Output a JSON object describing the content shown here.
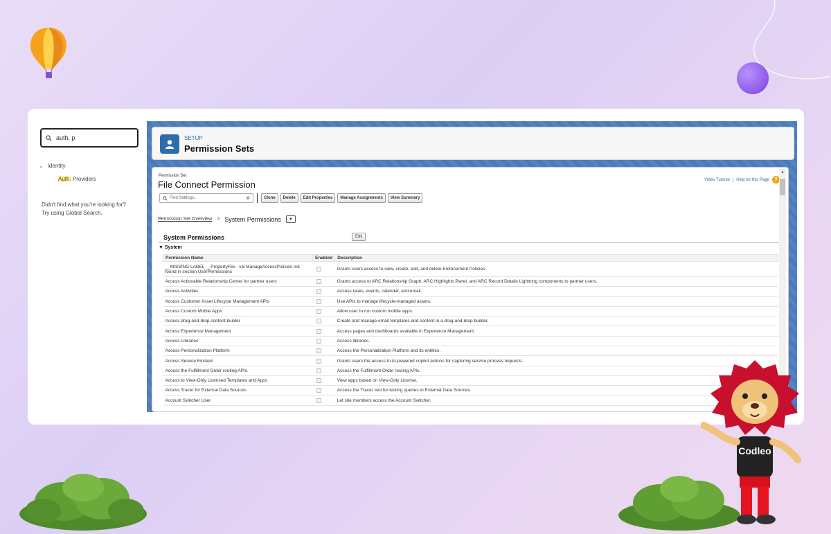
{
  "search": {
    "value": "auth. p"
  },
  "tree": {
    "parent": "Identity",
    "child_highlight": "Auth.",
    "child_rest": " Providers"
  },
  "not_found": {
    "line1": "Didn't find what you're looking for?",
    "line2": "Try using Global Search."
  },
  "header": {
    "setup": "SETUP",
    "title": "Permission Sets"
  },
  "permission_set": {
    "label": "Permission Set",
    "name": "File Connect Permission"
  },
  "help": {
    "video": "Video Tutorial",
    "sep": "|",
    "help": "Help for this Page"
  },
  "toolbar": {
    "find_placeholder": "Find Settings...",
    "buttons": [
      "Clone",
      "Delete",
      "Edit Properties",
      "Manage Assignments",
      "View Summary"
    ]
  },
  "breadcrumb": {
    "link": "Permission Set Overview",
    "sep": ">",
    "current": "System Permissions"
  },
  "section": {
    "title": "System Permissions",
    "edit": "Edit",
    "group": "System"
  },
  "table": {
    "headers": [
      "Permission Name",
      "Enabled",
      "Description"
    ],
    "rows": [
      [
        "__MISSING LABEL__ PropertyFile - val ManageAccessPolicies not found in section UserPermissions",
        "Grants users access to view, create, edit, and delete Enforcement Policies"
      ],
      [
        "Access Actionable Relationship Center for partner users",
        "Grants access to ARC Relationship Graph, ARC Highlights Panel, and ARC Record Details Lightning components to partner users."
      ],
      [
        "Access Activities",
        "Access tasks, events, calendar, and email."
      ],
      [
        "Access Customer Asset Lifecycle Management APIs",
        "Use APIs to manage lifecycle-managed assets."
      ],
      [
        "Access Custom Mobile Apps",
        "Allow user to run custom mobile apps."
      ],
      [
        "Access drag-and-drop content builder",
        "Create and manage email templates and content in a drag-and-drop builder."
      ],
      [
        "Access Experience Management",
        "Access pages and dashboards available in Experience Management."
      ],
      [
        "Access Libraries",
        "Access libraries."
      ],
      [
        "Access Personalization Platform",
        "Access the Personalization Platform and its entities."
      ],
      [
        "Access Service Einstein",
        "Grants users the access to AI-powered copilot actions for capturing service process requests."
      ],
      [
        "Access the Fulfillment Order routing APIs.",
        "Access the Fulfillment Order routing APIs."
      ],
      [
        "Access to View-Only Licensed Templates and Apps",
        "View apps based on View-Only License."
      ],
      [
        "Access Tracer for External Data Sources",
        "Access the Tracer tool for testing queries to External Data Sources."
      ],
      [
        "Account Switcher User",
        "Let site members access the Account Switcher."
      ]
    ]
  },
  "mascot": {
    "shirt_text": "Codleo"
  },
  "colors": {
    "setup_blue": "#2d6eaa",
    "header_band": "#4a7bbd",
    "highlight": "#fff59d",
    "help_icon": "#f2a500"
  }
}
